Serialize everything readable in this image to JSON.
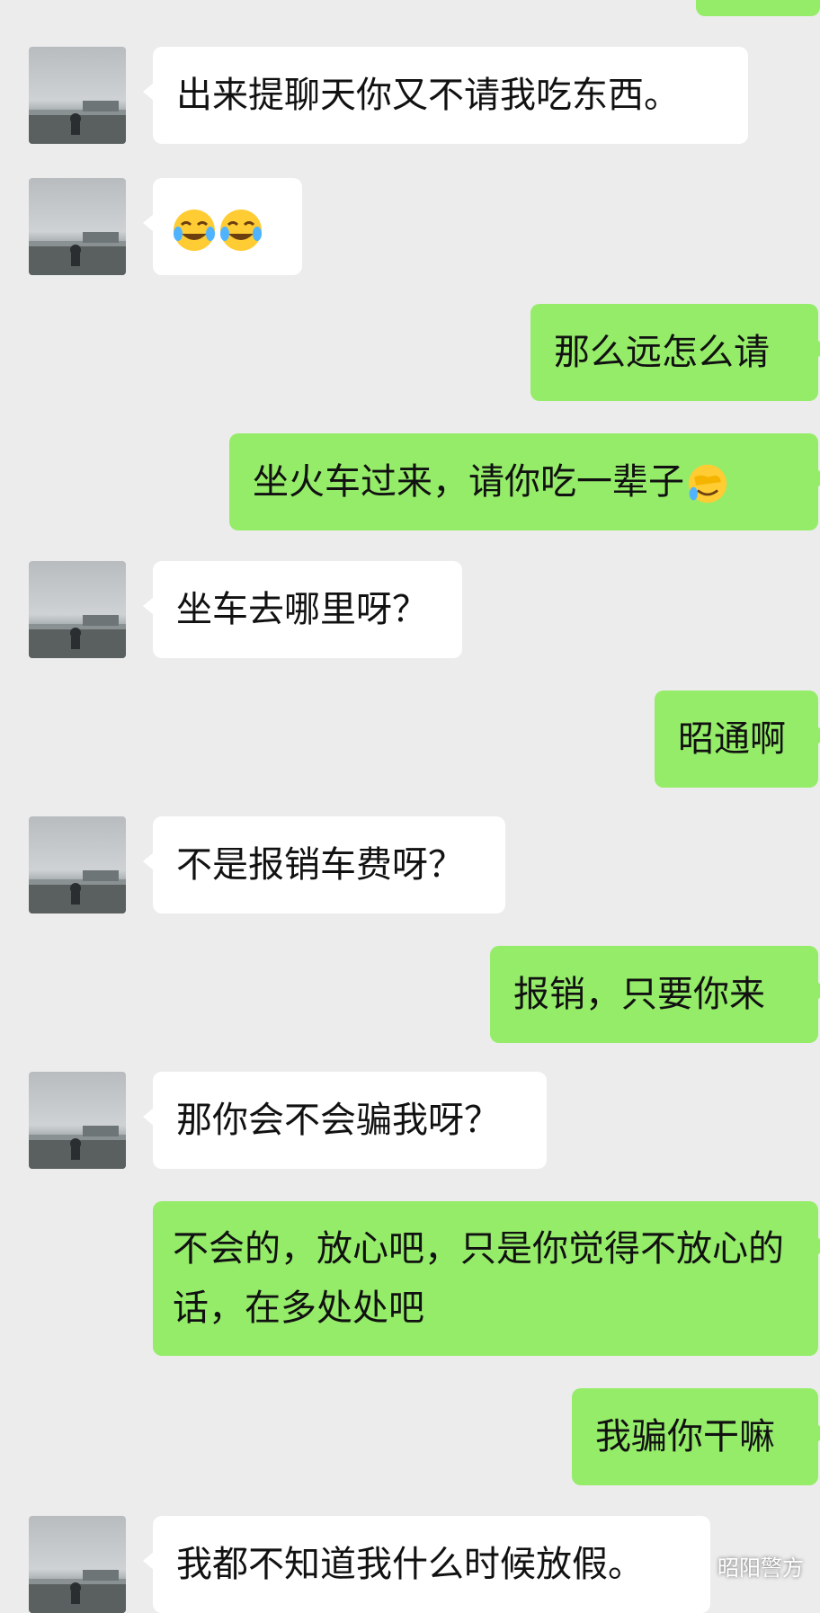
{
  "messages": [
    {
      "side": "left",
      "text": "出来提聊天你又不请我吃东西。"
    },
    {
      "side": "left",
      "text": "",
      "emoji": [
        "tears-of-joy-icon",
        "tears-of-joy-icon"
      ]
    },
    {
      "side": "right",
      "text": "那么远怎么请"
    },
    {
      "side": "right",
      "text": "坐火车过来，请你吃一辈子",
      "emoji": [
        "facepalm-laugh-icon"
      ]
    },
    {
      "side": "left",
      "text": "坐车去哪里呀？"
    },
    {
      "side": "right",
      "text": "昭通啊"
    },
    {
      "side": "left",
      "text": "不是报销车费呀？"
    },
    {
      "side": "right",
      "text": "报销，只要你来"
    },
    {
      "side": "left",
      "text": "那你会不会骗我呀？"
    },
    {
      "side": "right",
      "text": "不会的，放心吧，只是你觉得不放心的话，在多处处吧"
    },
    {
      "side": "right",
      "text": "我骗你干嘛"
    },
    {
      "side": "left",
      "text": "我都不知道我什么时候放假。"
    }
  ],
  "watermark": {
    "text": "昭阳警方"
  },
  "colors": {
    "background": "#ececec",
    "bubble_self": "#95ec69",
    "bubble_other": "#ffffff"
  }
}
